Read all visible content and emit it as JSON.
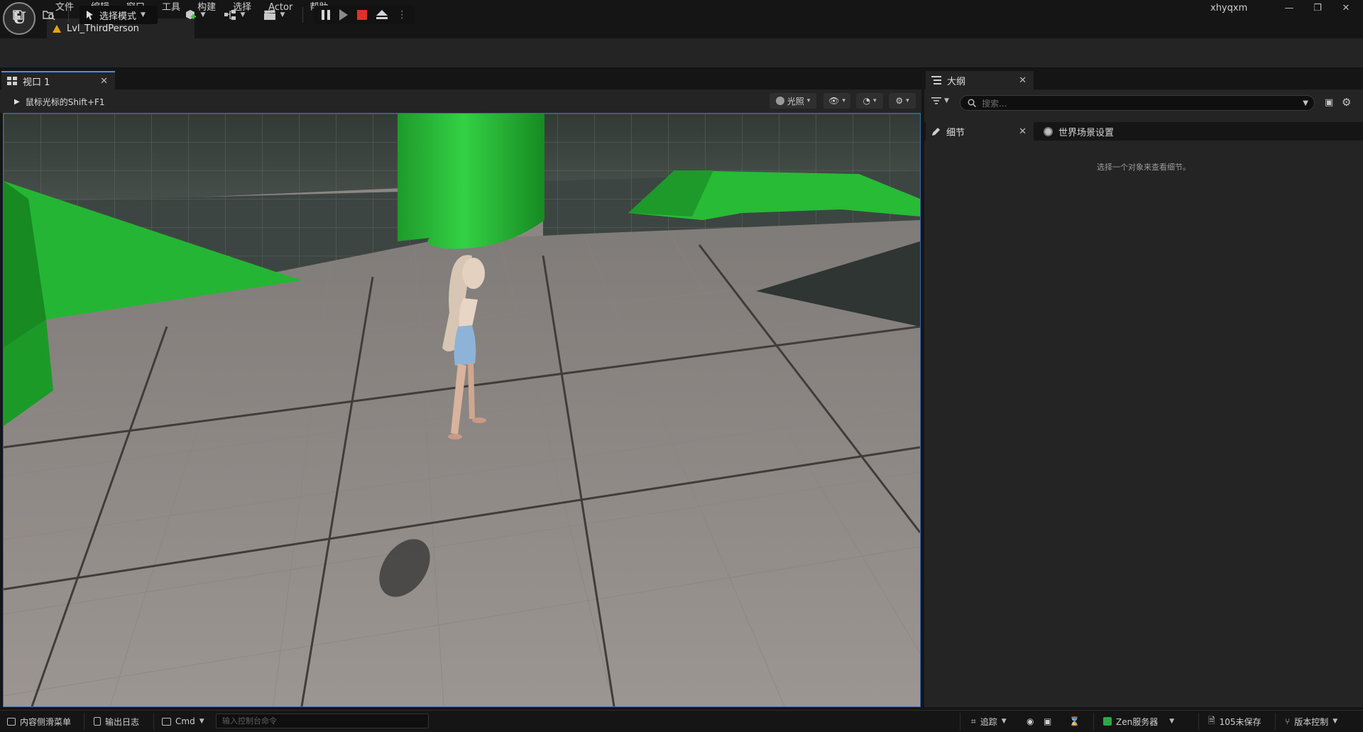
{
  "app": {
    "menu": [
      "文件",
      "编辑",
      "窗口",
      "工具",
      "构建",
      "选择",
      "Actor",
      "帮助"
    ],
    "level_tab": "Lvl_ThirdPerson",
    "user": "xhyqxm",
    "window_controls": {
      "minimize": "—",
      "restore": "❐",
      "close": "✕"
    }
  },
  "toolbar": {
    "mode_label": "选择模式"
  },
  "viewport": {
    "tab_label": "视口 1",
    "hint": "鼠标光标的Shift+F1",
    "lighting_label": "光照"
  },
  "outliner": {
    "tab_label": "大纲",
    "search_placeholder": "搜索..."
  },
  "details": {
    "tab_label": "细节",
    "world_tab_label": "世界场景设置",
    "empty_message": "选择一个对象来查看细节。"
  },
  "statusbar": {
    "content_drawer": "内容侧滑菜单",
    "output_log": "输出日志",
    "cmd": "Cmd",
    "console_placeholder": "输入控制台命令",
    "trace": "追踪",
    "zen": "Zen服务器",
    "unsaved": "105未保存",
    "source_control": "版本控制"
  },
  "colors": {
    "accent": "#4a8fe7",
    "stop": "#e0302a",
    "warning": "#e8a317",
    "scene_green": "#22b332",
    "floor": "#8c8682"
  }
}
